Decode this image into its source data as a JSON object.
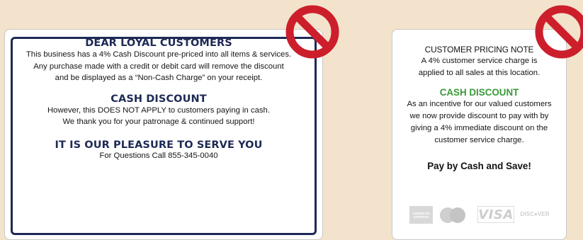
{
  "left_sign": {
    "heading1": "DEAR LOYAL CUSTOMERS",
    "para1": [
      "This business has a 4% Cash Discount pre-priced into all items & services.",
      "Any purchase made with a credit or debit card will remove the discount",
      "and be displayed as a “Non-Cash Charge” on your receipt."
    ],
    "heading2": "CASH DISCOUNT",
    "para2": [
      "However, this DOES NOT APPLY to customers paying in cash.",
      "We thank you for your patronage & continued support!"
    ],
    "heading3": "IT IS OUR PLEASURE TO SERVE YOU",
    "phone_line": "For Questions Call 855-345-0040"
  },
  "right_sign": {
    "title": "CUSTOMER PRICING NOTE",
    "para1": [
      "A 4% customer service charge is",
      "applied to all sales at this location."
    ],
    "heading": "CASH DISCOUNT",
    "para2": [
      "As an incentive for our valued customers",
      "we now provide discount to pay with by",
      "giving a 4% immediate discount on the",
      "customer service charge."
    ],
    "pay_line": "Pay by Cash and Save!",
    "card_logos": {
      "amex": "AMERICAN EXPRESS",
      "visa": "VISA",
      "discover": "DISC●VER"
    }
  },
  "colors": {
    "background": "#f3e3cc",
    "navy": "#1e2a55",
    "green": "#3a9a38",
    "prohibition_red": "#cc1f2b"
  },
  "icons": [
    "prohibition-icon",
    "mastercard-logo-icon"
  ]
}
